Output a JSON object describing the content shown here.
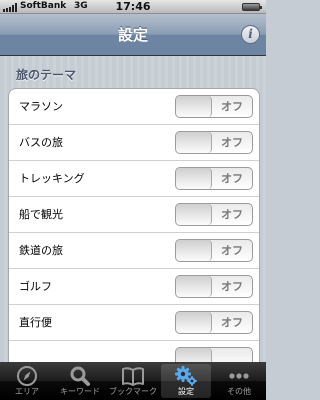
{
  "status_bar": {
    "carrier": "SoftBank",
    "network": "3G",
    "time": "17:46"
  },
  "nav": {
    "title": "設定",
    "info_label": "i"
  },
  "section": {
    "header": "旅のテーマ",
    "items": [
      {
        "label": "マラソン",
        "toggle": "オフ"
      },
      {
        "label": "バスの旅",
        "toggle": "オフ"
      },
      {
        "label": "トレッキング",
        "toggle": "オフ"
      },
      {
        "label": "船で観光",
        "toggle": "オフ"
      },
      {
        "label": "鉄道の旅",
        "toggle": "オフ"
      },
      {
        "label": "ゴルフ",
        "toggle": "オフ"
      },
      {
        "label": "直行便",
        "toggle": "オフ"
      },
      {
        "label": "",
        "toggle": ""
      }
    ]
  },
  "tab_bar": {
    "active_tab": "設定",
    "tabs": [
      {
        "label": "エリア",
        "icon": "compass-icon"
      },
      {
        "label": "キーワード",
        "icon": "magnifier-icon"
      },
      {
        "label": "ブックマーク",
        "icon": "book-icon"
      },
      {
        "label": "設定",
        "icon": "gear-icon"
      },
      {
        "label": "その他",
        "icon": "more-dots-icon"
      }
    ]
  }
}
